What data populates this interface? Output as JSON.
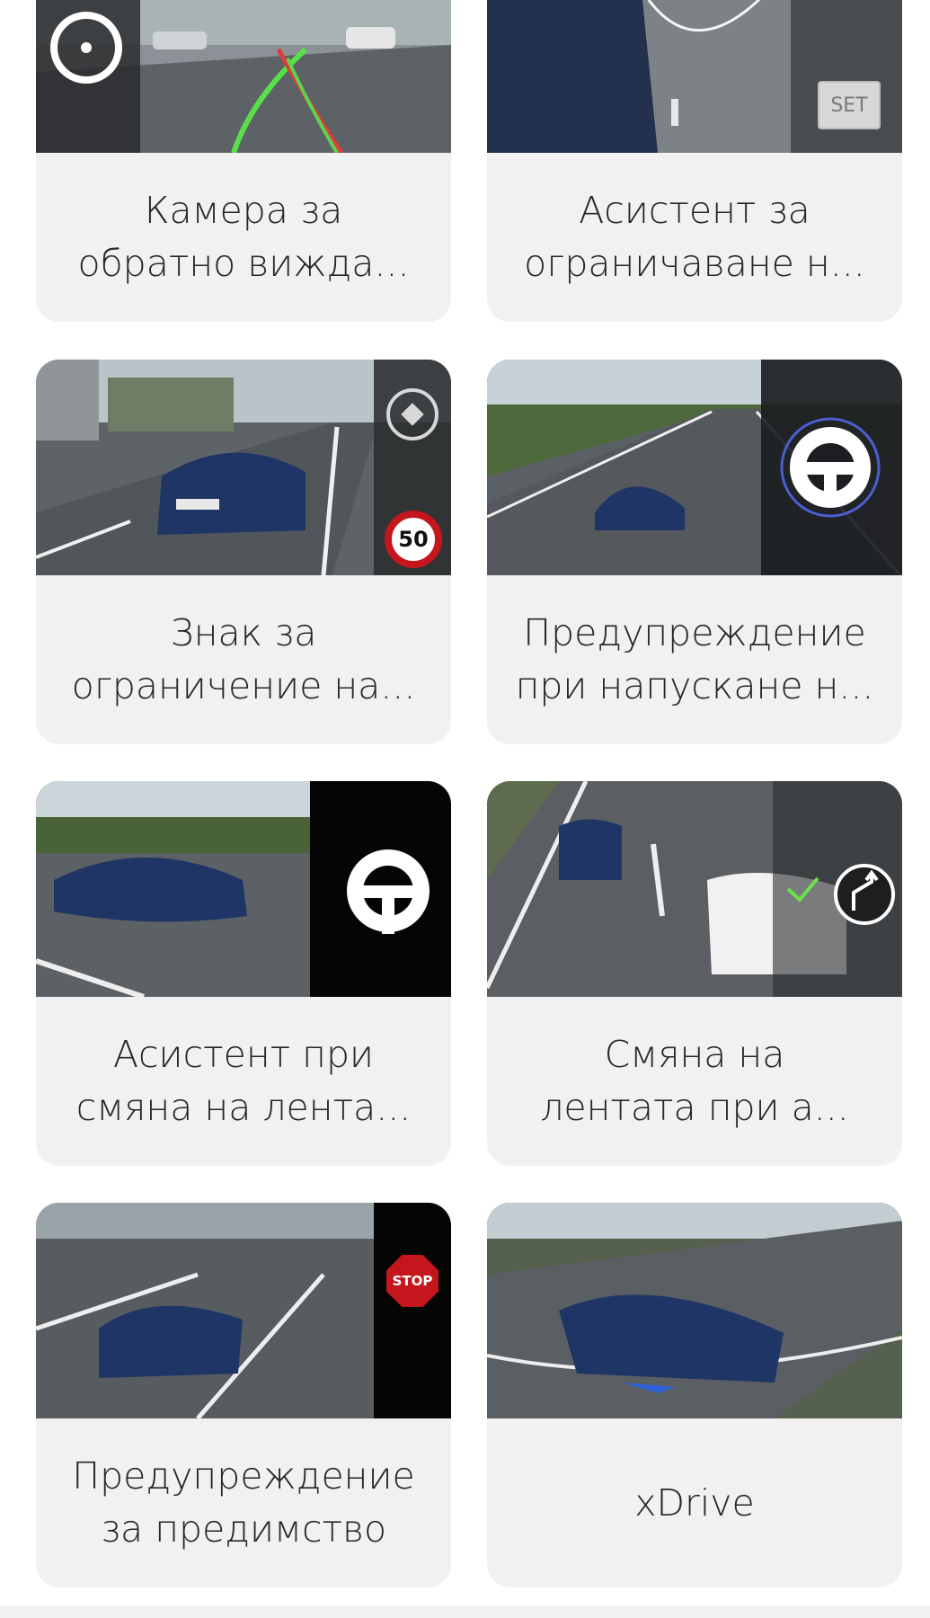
{
  "cards": [
    {
      "id": "rear-camera",
      "lines": [
        "Камера за",
        "обратно вижда..."
      ],
      "badge": "",
      "icon": "steering-wheel-icon"
    },
    {
      "id": "speed-limit-assistant",
      "lines": [
        "Асистент за",
        "ограничаване н..."
      ],
      "badge": "SET",
      "icon": "set-button-icon"
    },
    {
      "id": "speed-sign",
      "lines": [
        "Знак за",
        "ограничение на..."
      ],
      "badge": "50",
      "icon": "speed-limit-sign-icon"
    },
    {
      "id": "lane-departure",
      "lines": [
        "Предупреждение",
        "при напускане н..."
      ],
      "badge": "",
      "icon": "steering-wheel-icon"
    },
    {
      "id": "lane-change-assistant",
      "lines": [
        "Асистент при",
        "смяна на лента..."
      ],
      "badge": "",
      "icon": "steering-wheel-icon"
    },
    {
      "id": "auto-lane-change",
      "lines": [
        "Смяна на",
        "лентата при а..."
      ],
      "badge": "",
      "icon": "lane-change-icon"
    },
    {
      "id": "right-of-way",
      "lines": [
        "Предупреждение",
        "за предимство"
      ],
      "badge": "STOP",
      "icon": "stop-sign-icon"
    },
    {
      "id": "xdrive",
      "lines": [
        "xDrive"
      ],
      "badge": "",
      "icon": ""
    }
  ],
  "colors": {
    "card_bg": "#f1f1f1",
    "text": "#262626",
    "car_blue": "#1f3566",
    "sign_red": "#c4161c"
  }
}
